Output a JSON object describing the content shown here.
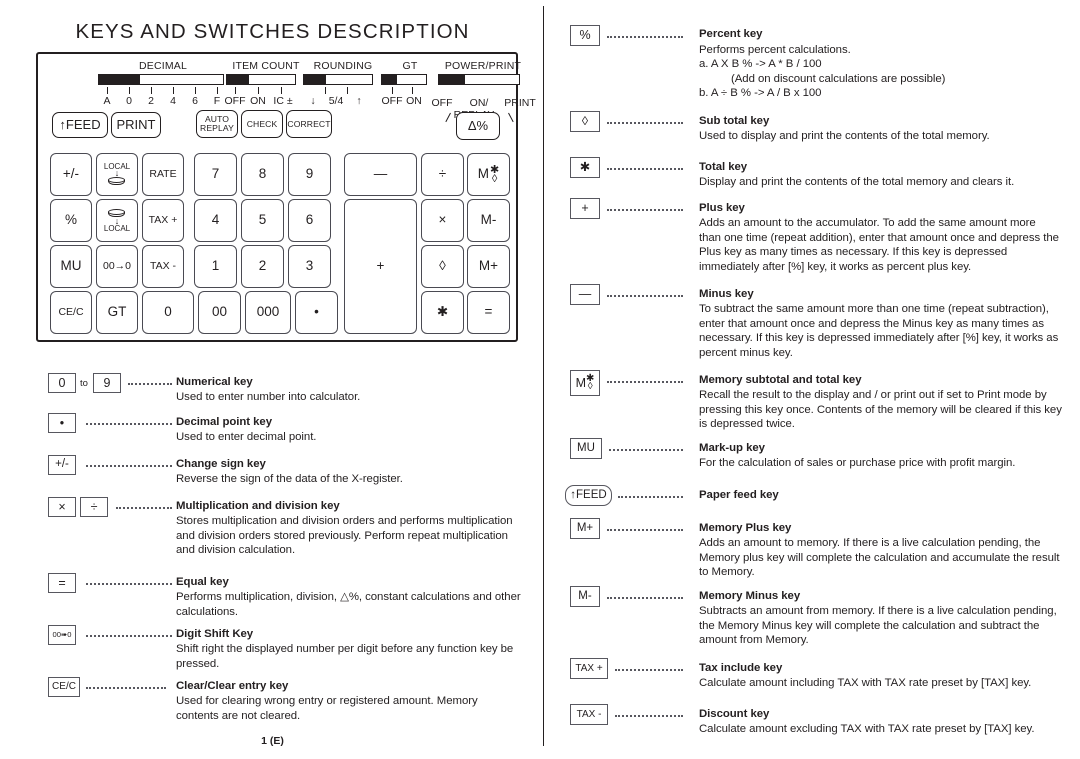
{
  "page": {
    "title": "KEYS AND SWITCHES DESCRIPTION",
    "footer": "1 (E)"
  },
  "calculator": {
    "switches": [
      {
        "name": "DECIMAL",
        "labels": [
          "A",
          "0",
          "2",
          "4",
          "6",
          "F"
        ]
      },
      {
        "name": "ITEM COUNT",
        "labels": [
          "OFF",
          "ON",
          "IC ±"
        ]
      },
      {
        "name": "ROUNDING",
        "labels": [
          "↓",
          "5/4",
          "↑"
        ]
      },
      {
        "name": "GT",
        "labels": [
          "OFF",
          "ON"
        ]
      },
      {
        "name": "POWER/PRINT",
        "labels": [
          "OFF",
          "ON/",
          "PRINT"
        ],
        "sublabel": "REPLAY"
      }
    ],
    "panel_keys": [
      {
        "label": "↑FEED"
      },
      {
        "label": "PRINT"
      },
      {
        "label": "AUTO\nREPLAY"
      },
      {
        "label": "CHECK"
      },
      {
        "label": "CORRECT"
      },
      {
        "label": "Δ%"
      }
    ],
    "keypad": [
      {
        "label": "+/-"
      },
      {
        "label": "LOCAL",
        "icon": "local-down-cylinder-icon"
      },
      {
        "label": "RATE"
      },
      {
        "label": "7"
      },
      {
        "label": "8"
      },
      {
        "label": "9"
      },
      {
        "label": "—"
      },
      {
        "label": "÷"
      },
      {
        "label": "M",
        "icon": "memory-total-icon"
      },
      {
        "label": "%"
      },
      {
        "label": "LOCAL",
        "icon": "cylinder-down-local-icon"
      },
      {
        "label": "TAX +"
      },
      {
        "label": "4"
      },
      {
        "label": "5"
      },
      {
        "label": "6"
      },
      {
        "label": "×"
      },
      {
        "label": "M-"
      },
      {
        "label": "MU"
      },
      {
        "label": "00→0"
      },
      {
        "label": "TAX -"
      },
      {
        "label": "1"
      },
      {
        "label": "2"
      },
      {
        "label": "3"
      },
      {
        "label": "+"
      },
      {
        "label": "◊"
      },
      {
        "label": "M+"
      },
      {
        "label": "CE/C"
      },
      {
        "label": "GT"
      },
      {
        "label": "0"
      },
      {
        "label": "00"
      },
      {
        "label": "000"
      },
      {
        "label": "•"
      },
      {
        "label": "✱"
      },
      {
        "label": "="
      }
    ]
  },
  "left_column": {
    "entries": [
      {
        "keys": [
          "0",
          "9"
        ],
        "separator": "to",
        "title": "Numerical key",
        "body": "Used to enter number into calculator."
      },
      {
        "keys": [
          "•"
        ],
        "title": "Decimal point key",
        "body": "Used to enter decimal point."
      },
      {
        "keys": [
          "+/-"
        ],
        "title": "Change sign key",
        "body": "Reverse the sign of the data of the X-register."
      },
      {
        "keys": [
          "×",
          "÷"
        ],
        "title": "Multiplication and division key",
        "body": "Stores multiplication and division orders and performs multiplication and division orders stored previously. Perform repeat multiplication and division calculation."
      },
      {
        "keys": [
          "="
        ],
        "title": "Equal key",
        "body": "Performs multiplication, division, △%, constant calculations and other calculations."
      },
      {
        "keys": [
          "00➠0"
        ],
        "title": "Digit Shift Key",
        "body": "Shift right the displayed number per digit before any function key be pressed."
      },
      {
        "keys": [
          "CE/C"
        ],
        "title": "Clear/Clear entry key",
        "body": "Used for clearing wrong entry or registered amount. Memory contents are not cleared."
      }
    ]
  },
  "right_column": {
    "entries": [
      {
        "keys": [
          "%"
        ],
        "title": "Percent key",
        "body": "Performs percent calculations.",
        "list": [
          "a.   A X B % -> A * B / 100",
          "(Add on discount calculations are possible)",
          "b.   A ÷ B % -> A / B x 100"
        ]
      },
      {
        "keys": [
          "◊"
        ],
        "title": "Sub total key",
        "body": "Used to display and print the contents of the total memory."
      },
      {
        "keys": [
          "✱"
        ],
        "title": "Total key",
        "body": "Display and print the contents of the total memory and clears it."
      },
      {
        "keys": [
          "+"
        ],
        "title": "Plus key",
        "body": "Adds an amount to the accumulator. To add the same amount more than one time (repeat addition), enter that amount once and depress the Plus key as many times as necessary. If this key is depressed immediately after [%] key, it works as percent plus key."
      },
      {
        "keys": [
          "—"
        ],
        "title": "Minus key",
        "body": "To subtract the same amount more than one time (repeat subtraction), enter that amount once and depress the Minus key as many times as necessary. If this key is depressed immediately after [%] key, it works as percent minus key."
      },
      {
        "keys": [
          "M"
        ],
        "key_icon": "memory-total-icon",
        "title": "Memory subtotal and total key",
        "body": "Recall the result to the display and / or print out if set to Print mode by pressing this key once. Contents of the memory will be cleared if this key is depressed twice."
      },
      {
        "keys": [
          "MU"
        ],
        "title": "Mark-up key",
        "body": "For the calculation of sales or purchase price with profit margin."
      },
      {
        "keys": [
          "↑FEED"
        ],
        "title": "Paper feed key",
        "body": ""
      },
      {
        "keys": [
          "M+"
        ],
        "title": "Memory Plus key",
        "body": "Adds an amount to memory. If there is a live calculation pending, the Memory plus key will complete the calculation and accumulate the result to Memory."
      },
      {
        "keys": [
          "M-"
        ],
        "title": "Memory Minus key",
        "body": "Subtracts an amount from memory. If there is a live calculation pending, the Memory Minus key will complete the calculation and subtract the amount from Memory."
      },
      {
        "keys": [
          "TAX +"
        ],
        "title": "Tax include key",
        "body": "Calculate amount including TAX with TAX rate preset by [TAX] key."
      },
      {
        "keys": [
          "TAX -"
        ],
        "title": "Discount key",
        "body": "Calculate amount excluding TAX with TAX rate preset by [TAX] key."
      }
    ]
  }
}
